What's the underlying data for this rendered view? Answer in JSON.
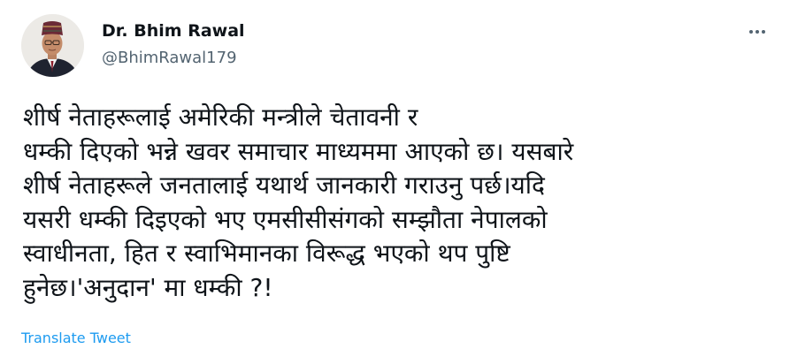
{
  "author": {
    "name": "Dr. Bhim Rawal",
    "handle": "@BhimRawal179"
  },
  "more_menu_icon": "ellipsis-icon",
  "tweet": {
    "lines": [
      "शीर्ष नेताहरूलाई अमेरिकी मन्त्रीले चेतावनी र",
      "धम्की दिएको भन्ने खवर समाचार माध्यममा आएको छ। यसबारे",
      "शीर्ष नेताहरूले जनतालाई यथार्थ जानकारी गराउनु पर्छ।यदि",
      "यसरी धम्की दिइएको भए एमसीसीसंगको सम्झौता नेपालको",
      "स्वाधीनता, हित र स्वाभिमानका विरूद्ध भएको थप पुष्टि",
      "हुनेछ।'अनुदान' मा धम्की ?!"
    ]
  },
  "translate_label": "Translate Tweet",
  "colors": {
    "text": "#0f1419",
    "secondary": "#536471",
    "link": "#1d9bf0"
  }
}
